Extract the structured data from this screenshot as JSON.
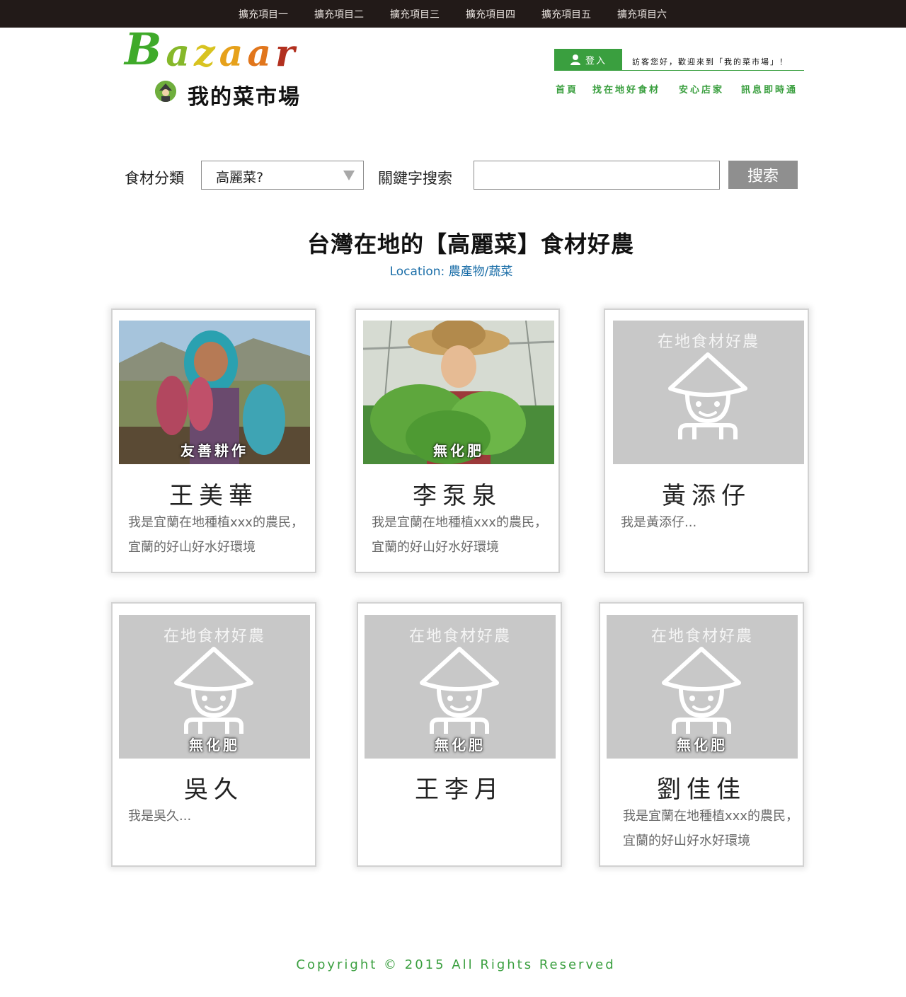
{
  "topbar": {
    "items": [
      "擴充項目一",
      "擴充項目二",
      "擴充項目三",
      "擴充項目四",
      "擴充項目五",
      "擴充項目六"
    ]
  },
  "logo": {
    "word": [
      "B",
      "a",
      "z",
      "a",
      "a",
      "r"
    ],
    "subtitle": "我的菜市場"
  },
  "header": {
    "login_label": "登入",
    "welcome": "訪客您好，歡迎來到「我的菜市場」！",
    "nav": [
      "首頁",
      "找在地好食材",
      "安心店家",
      "訊息即時通"
    ]
  },
  "search": {
    "category_label": "食材分類",
    "category_value": "高麗菜?",
    "keyword_label": "關鍵字搜索",
    "keyword_value": "",
    "button_label": "搜索"
  },
  "page": {
    "title": "台灣在地的【高麗菜】食材好農",
    "location_label": "Location:",
    "location_value": "農產物/蔬菜"
  },
  "placeholder_caption": "在地食材好農",
  "cards": [
    {
      "name": "王美華",
      "tag": "友善耕作",
      "photo": "farmer-photo",
      "desc": "我是宜蘭在地種植xxx的農民，宜蘭的好山好水好環境"
    },
    {
      "name": "李泵泉",
      "tag": "無化肥",
      "photo": "farmer-photo",
      "desc": "我是宜蘭在地種植xxx的農民，宜蘭的好山好水好環境"
    },
    {
      "name": "黃添仔",
      "tag": "",
      "photo": "placeholder",
      "desc": "我是黃添仔..."
    },
    {
      "name": "吳久",
      "tag": "無化肥",
      "photo": "placeholder",
      "desc": "我是吳久..."
    },
    {
      "name": "王李月",
      "tag": "無化肥",
      "photo": "placeholder",
      "desc": ""
    },
    {
      "name": "劉佳佳",
      "tag": "無化肥",
      "photo": "placeholder",
      "desc": "我是宜蘭在地種植xxx的農民，宜蘭的好山好水好環境"
    }
  ],
  "footer": {
    "copyright": "Copyright © 2015 All Rights Reserved"
  },
  "colors": {
    "accent_green": "#3a9f3f",
    "topbar_bg": "#221a18",
    "link_blue": "#1b6ea8",
    "placeholder_gray": "#c8c8c8",
    "button_gray": "#8f8f8f"
  }
}
